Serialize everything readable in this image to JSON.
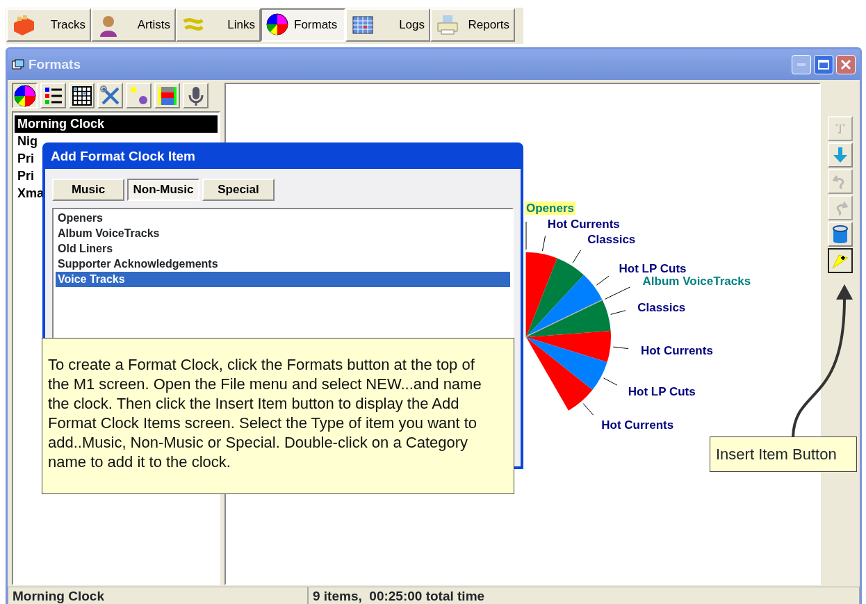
{
  "toolbar": [
    {
      "label": "Tracks",
      "kind": "crate",
      "selected": false
    },
    {
      "label": "Artists",
      "kind": "person",
      "selected": false
    },
    {
      "label": "Links",
      "kind": "link",
      "selected": false
    },
    {
      "label": "Formats",
      "kind": "pie",
      "selected": true
    },
    {
      "label": "Logs",
      "kind": "calendar",
      "selected": false
    },
    {
      "label": "Reports",
      "kind": "printer",
      "selected": false
    }
  ],
  "window": {
    "title": "Formats"
  },
  "format_tools": [
    {
      "kind": "pie",
      "selected": true
    },
    {
      "kind": "list",
      "selected": false
    },
    {
      "kind": "grid",
      "selected": false
    },
    {
      "kind": "tools",
      "selected": false
    },
    {
      "kind": "dots",
      "selected": false
    },
    {
      "kind": "bars",
      "selected": false
    },
    {
      "kind": "mic",
      "selected": false
    }
  ],
  "clocks": [
    {
      "label": "Morning Clock",
      "selected": true
    },
    {
      "label": "Nig",
      "selected": false
    },
    {
      "label": "Pri",
      "selected": false
    },
    {
      "label": "Pri",
      "selected": false
    },
    {
      "label": "Xma",
      "selected": false
    }
  ],
  "chart": {
    "segments": [
      {
        "label": "Openers",
        "kind": "non-music",
        "selected": true
      },
      {
        "label": "Hot Currents",
        "kind": "music",
        "color": "#ff0000",
        "selected": false
      },
      {
        "label": "Classics",
        "kind": "music",
        "color": "#008040",
        "selected": false
      },
      {
        "label": "Hot LP Cuts",
        "kind": "music",
        "color": "#0080ff",
        "selected": false
      },
      {
        "label": "Album VoiceTracks",
        "kind": "non-music",
        "selected": false
      },
      {
        "label": "Classics",
        "kind": "music",
        "color": "#008040",
        "selected": false
      },
      {
        "label": "Hot Currents",
        "kind": "music",
        "color": "#ff0000",
        "selected": false
      },
      {
        "label": "Hot LP Cuts",
        "kind": "music",
        "color": "#0080ff",
        "selected": false
      },
      {
        "label": "Hot Currents",
        "kind": "music",
        "color": "#ff0000",
        "selected": false
      }
    ]
  },
  "side_buttons": [
    {
      "kind": "up",
      "disabled": true,
      "selected": false
    },
    {
      "kind": "down",
      "disabled": false,
      "selected": false
    },
    {
      "kind": "undo",
      "disabled": true,
      "selected": false
    },
    {
      "kind": "redo",
      "disabled": true,
      "selected": false
    },
    {
      "kind": "bin",
      "disabled": false,
      "selected": false
    },
    {
      "kind": "insert",
      "disabled": false,
      "selected": true
    }
  ],
  "dialog": {
    "title": "Add Format Clock Item",
    "tabs": [
      {
        "label": "Music",
        "selected": false
      },
      {
        "label": "Non-Music",
        "selected": true
      },
      {
        "label": "Special",
        "selected": false
      }
    ],
    "items": [
      {
        "label": "Openers",
        "selected": false
      },
      {
        "label": "Album VoiceTracks",
        "selected": false
      },
      {
        "label": "Old Liners",
        "selected": false
      },
      {
        "label": "Supporter Acknowledgements",
        "selected": false
      },
      {
        "label": "Voice Tracks",
        "selected": true
      }
    ]
  },
  "note": {
    "text": "To create a Format Clock, click the Formats button at the top of the M1 screen.  Open the File menu and select NEW...and name the clock. Then click the Insert Item button to display the Add Format Clock Items screen.  Select the Type of item you want to add..Music, Non-Music or Special. Double-click on a Category name to add it to the clock."
  },
  "callout": {
    "text": "Insert Item Button"
  },
  "status_bar": {
    "left": "Morning Clock",
    "right": "9 items,  00:25:00 total time"
  }
}
